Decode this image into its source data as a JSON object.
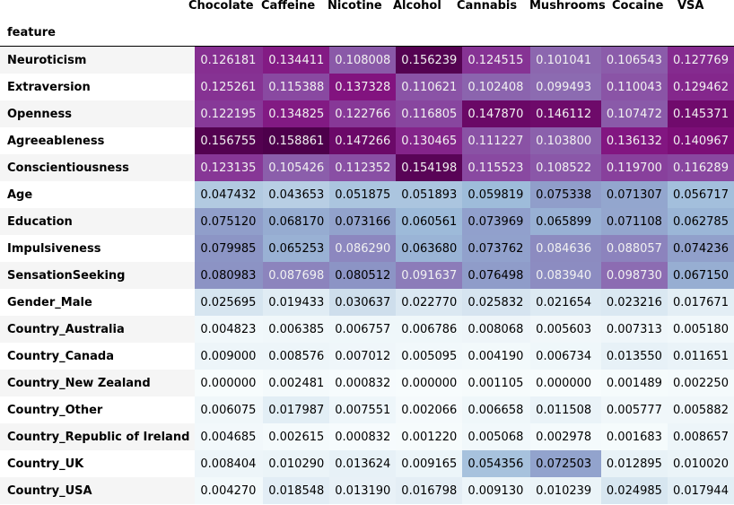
{
  "chart_data": {
    "type": "heatmap",
    "index_name": "feature",
    "columns": [
      "Chocolate",
      "Caffeine",
      "Nicotine",
      "Alcohol",
      "Cannabis",
      "Mushrooms",
      "Cocaine",
      "VSA"
    ],
    "rows": [
      "Neuroticism",
      "Extraversion",
      "Openness",
      "Agreeableness",
      "Conscientiousness",
      "Age",
      "Education",
      "Impulsiveness",
      "SensationSeeking",
      "Gender_Male",
      "Country_Australia",
      "Country_Canada",
      "Country_New Zealand",
      "Country_Other",
      "Country_Republic of Ireland",
      "Country_UK",
      "Country_USA"
    ],
    "values": [
      [
        "0.126181",
        "0.134411",
        "0.108008",
        "0.156239",
        "0.124515",
        "0.101041",
        "0.106543",
        "0.127769"
      ],
      [
        "0.125261",
        "0.115388",
        "0.137328",
        "0.110621",
        "0.102408",
        "0.099493",
        "0.110043",
        "0.129462"
      ],
      [
        "0.122195",
        "0.134825",
        "0.122766",
        "0.116805",
        "0.147870",
        "0.146112",
        "0.107472",
        "0.145371"
      ],
      [
        "0.156755",
        "0.158861",
        "0.147266",
        "0.130465",
        "0.111227",
        "0.103800",
        "0.136132",
        "0.140967"
      ],
      [
        "0.123135",
        "0.105426",
        "0.112352",
        "0.154198",
        "0.115523",
        "0.108522",
        "0.119700",
        "0.116289"
      ],
      [
        "0.047432",
        "0.043653",
        "0.051875",
        "0.051893",
        "0.059819",
        "0.075338",
        "0.071307",
        "0.056717"
      ],
      [
        "0.075120",
        "0.068170",
        "0.073166",
        "0.060561",
        "0.073969",
        "0.065899",
        "0.071108",
        "0.062785"
      ],
      [
        "0.079985",
        "0.065253",
        "0.086290",
        "0.063680",
        "0.073762",
        "0.084636",
        "0.088057",
        "0.074236"
      ],
      [
        "0.080983",
        "0.087698",
        "0.080512",
        "0.091637",
        "0.076498",
        "0.083940",
        "0.098730",
        "0.067150"
      ],
      [
        "0.025695",
        "0.019433",
        "0.030637",
        "0.022770",
        "0.025832",
        "0.021654",
        "0.023216",
        "0.017671"
      ],
      [
        "0.004823",
        "0.006385",
        "0.006757",
        "0.006786",
        "0.008068",
        "0.005603",
        "0.007313",
        "0.005180"
      ],
      [
        "0.009000",
        "0.008576",
        "0.007012",
        "0.005095",
        "0.004190",
        "0.006734",
        "0.013550",
        "0.011651"
      ],
      [
        "0.000000",
        "0.002481",
        "0.000832",
        "0.000000",
        "0.001105",
        "0.000000",
        "0.001489",
        "0.002250"
      ],
      [
        "0.006075",
        "0.017987",
        "0.007551",
        "0.002066",
        "0.006658",
        "0.011508",
        "0.005777",
        "0.005882"
      ],
      [
        "0.004685",
        "0.002615",
        "0.000832",
        "0.001220",
        "0.005068",
        "0.002978",
        "0.001683",
        "0.008657"
      ],
      [
        "0.008404",
        "0.010290",
        "0.013624",
        "0.009165",
        "0.054356",
        "0.072503",
        "0.012895",
        "0.010020"
      ],
      [
        "0.004270",
        "0.018548",
        "0.013190",
        "0.016798",
        "0.009130",
        "0.010239",
        "0.024985",
        "0.017944"
      ]
    ],
    "colormap": "BuPu",
    "color_range": [
      0.0,
      0.158861
    ]
  }
}
